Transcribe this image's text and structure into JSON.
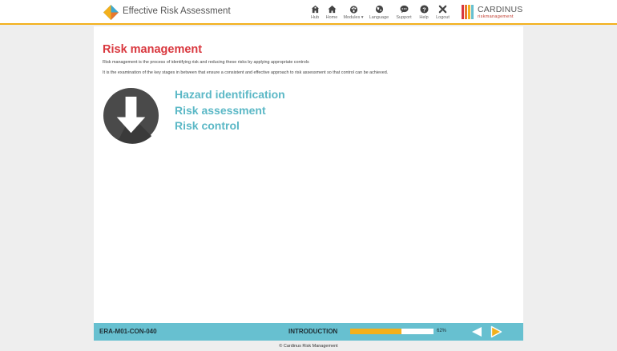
{
  "header": {
    "app_title": "Effective Risk Assessment",
    "nav": [
      {
        "label": "Hub",
        "icon": "hub-icon"
      },
      {
        "label": "Home",
        "icon": "home-icon"
      },
      {
        "label": "Modules ▾",
        "icon": "modules-icon"
      },
      {
        "label": "Language",
        "icon": "globe-icon"
      },
      {
        "label": "Support",
        "icon": "chat-icon"
      },
      {
        "label": "Help",
        "icon": "help-icon"
      },
      {
        "label": "Logout",
        "icon": "close-icon"
      }
    ],
    "brand": {
      "name": "CARDINUS",
      "sub": "riskmanagement"
    }
  },
  "page": {
    "heading": "Risk management",
    "paragraphs": [
      "Risk management is the process of identifying risk and reducing these risks by applying appropriate controls",
      "It is the examination of the key stages in between that ensure a consistent and effective approach to risk assessment so that control can be achieved."
    ],
    "stages": [
      "Hazard identification",
      "Risk assessment",
      "Risk control"
    ],
    "stages_icon": "down-arrow-icon"
  },
  "footer": {
    "code": "ERA-M01-CON-040",
    "section": "INTRODUCTION",
    "progress_percent": 62,
    "progress_label": "62%",
    "prev_icon": "prev-arrow-icon",
    "next_icon": "next-arrow-icon"
  },
  "copyright": "© Cardinus Risk Management",
  "colors": {
    "accent": "#f3b01c",
    "heading": "#d9373e",
    "stage_text": "#5bb8c6",
    "footer_bg": "#67c0d0"
  }
}
